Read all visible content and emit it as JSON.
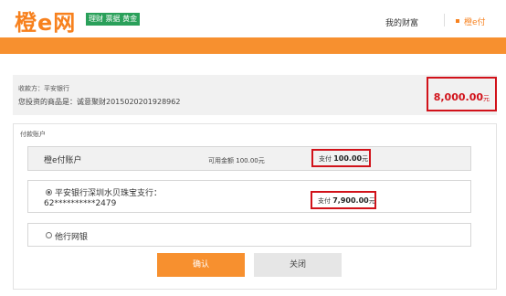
{
  "header": {
    "logo_text_1": "橙",
    "logo_text_e": "e",
    "logo_text_2": "网",
    "logo_tag": "理财 票据 黄金",
    "nav_my_wealth": "我的财富",
    "nav_cheng_e_pay": "橙e付"
  },
  "order": {
    "payee": "收款方：平安银行",
    "goods": "您投资的商品是：诚意聚财2015020201928962",
    "amount": "8,000.00",
    "amount_unit": "元"
  },
  "payment": {
    "title": "付款账户",
    "account_name": "橙e付账户",
    "available_label": "可用金额",
    "available_value": "100.00元",
    "pay1_label": "支付",
    "pay1_amount": "100.00",
    "pay1_unit": "元",
    "bank_name": "平安银行深圳水贝珠宝支行：",
    "bank_card": "62**********2479",
    "pay2_label": "支付",
    "pay2_amount": "7,900.00",
    "pay2_unit": "元",
    "other_bank": "他行网银"
  },
  "buttons": {
    "confirm": "确认",
    "close": "关闭"
  },
  "colors": {
    "brand_orange": "#f7902f",
    "highlight_red": "#d1121a",
    "tag_green": "#2aa05a"
  }
}
